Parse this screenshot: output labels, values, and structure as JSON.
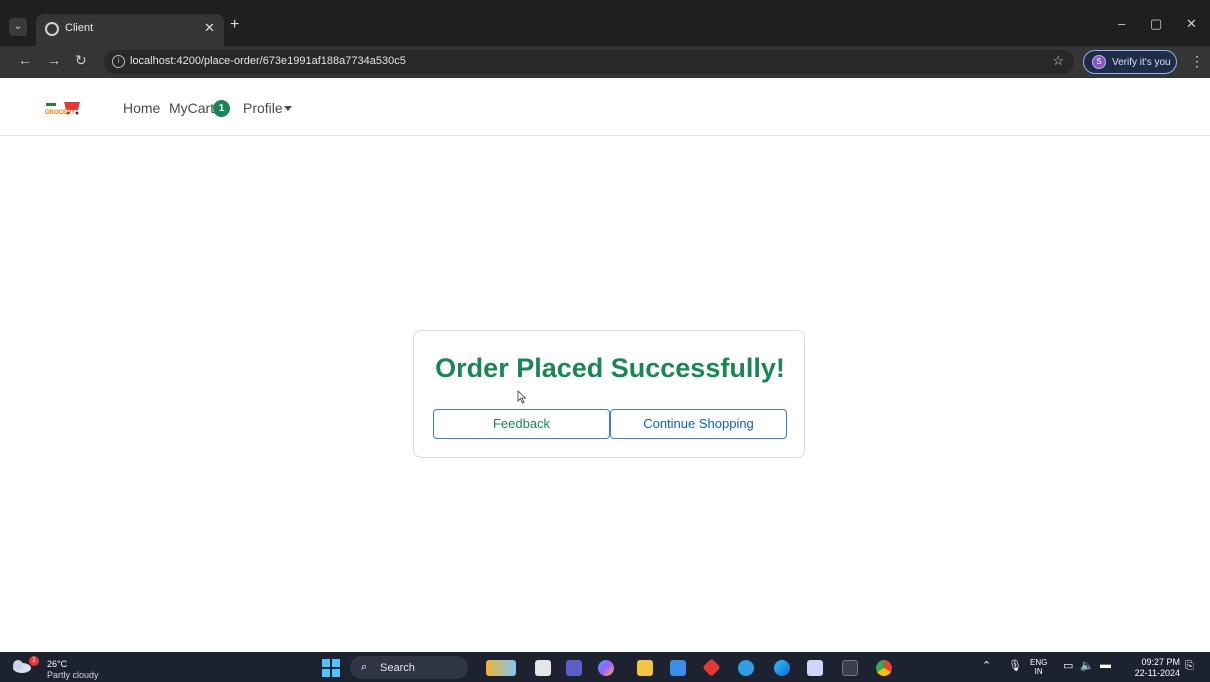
{
  "browser": {
    "tab_title": "Client",
    "url": "localhost:4200/place-order/673e1991af188a7734a530c5",
    "verify_label": "Verify it's you",
    "verify_badge": "S"
  },
  "navbar": {
    "logo_text": "GROCERY",
    "home": "Home",
    "mycart": "MyCart",
    "cart_count": "1",
    "profile": "Profile"
  },
  "main": {
    "heading": "Order Placed Successfully!",
    "feedback_label": "Feedback",
    "continue_label": "Continue Shopping"
  },
  "taskbar": {
    "temperature": "26°C",
    "condition": "Partly cloudy",
    "weather_badge": "1",
    "search_label": "Search",
    "lang_top": "ENG",
    "lang_bottom": "IN",
    "time": "09:27 PM",
    "date": "22-11-2024"
  },
  "colors": {
    "success": "#198754",
    "primary": "#0d6efd"
  }
}
